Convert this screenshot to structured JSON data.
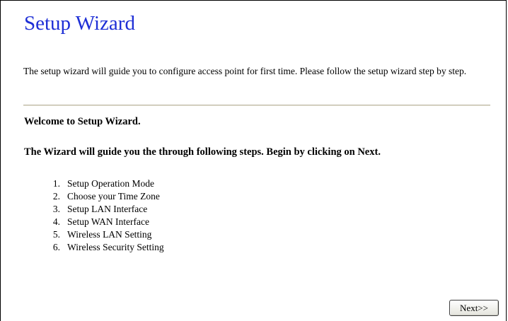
{
  "page": {
    "title": "Setup Wizard",
    "title_color": "#1e2fd6",
    "intro": "The setup wizard will guide you to configure access point for first time. Please follow the setup wizard step by step.",
    "welcome": "Welcome to Setup Wizard.",
    "guide": "The Wizard will guide you the through following steps. Begin by clicking on Next."
  },
  "steps": [
    {
      "number": "1.",
      "label": "Setup Operation Mode"
    },
    {
      "number": "2.",
      "label": "Choose your Time Zone"
    },
    {
      "number": "3.",
      "label": "Setup LAN Interface"
    },
    {
      "number": "4.",
      "label": "Setup WAN Interface"
    },
    {
      "number": "5.",
      "label": "Wireless LAN Setting"
    },
    {
      "number": "6.",
      "label": "Wireless Security Setting"
    }
  ],
  "buttons": {
    "next_label": "Next>>"
  }
}
